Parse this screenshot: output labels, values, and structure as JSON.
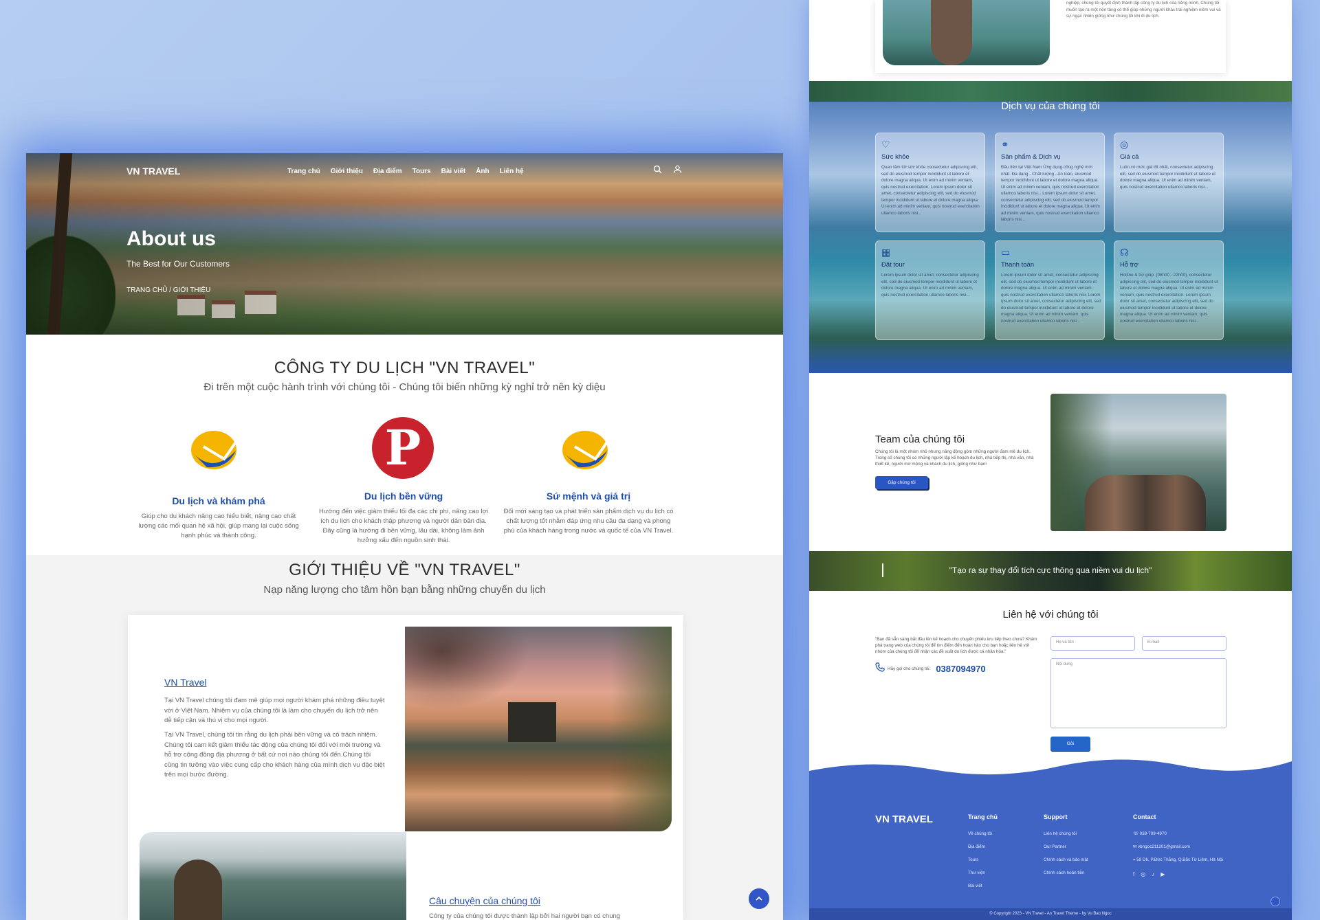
{
  "brand": "VN TRAVEL",
  "nav": [
    "Trang chủ",
    "Giới thiệu",
    "Địa điểm",
    "Tours",
    "Bài viết",
    "Ảnh",
    "Liên hệ"
  ],
  "hero": {
    "title": "About us",
    "subtitle": "The Best for Our Customers",
    "breadcrumb": "TRANG CHỦ / GIỚI THIỆU"
  },
  "company": {
    "title": "CÔNG TY DU LỊCH \"VN TRAVEL\"",
    "subtitle": "Đi trên một cuộc hành trình với chúng tôi - Chúng tôi biến những kỳ nghỉ trở nên kỳ diệu"
  },
  "features": [
    {
      "title": "Du lịch và khám phá",
      "text": "Giúp cho du khách nâng cao hiểu biết, nâng cao chất lượng các mối quan hệ xã hội, giúp mang lại cuộc sống hạnh phúc và thành công."
    },
    {
      "title": "Du lịch bền vững",
      "text": "Hướng đến việc giảm thiểu tối đa các chi phí, nâng cao lợi ích du lịch cho khách thập phương và người dân bản địa. Đây cũng là hướng đi bền vững, lâu dài, không làm ảnh hưởng xấu đến nguồn sinh thái."
    },
    {
      "title": "Sứ mệnh và giá trị",
      "text": "Đổi mới sáng tạo và phát triển sản phẩm dịch vụ du lịch có chất lượng tốt nhằm đáp ứng nhu cầu đa dạng và phong phú của khách hàng trong nước và quốc tế của VN Travel."
    }
  ],
  "about": {
    "title": "GIỚI THIỆU VỀ \"VN TRAVEL\"",
    "subtitle": "Nạp năng lượng cho tâm hồn bạn bằng những chuyến du lịch",
    "link1": "VN Travel",
    "p1": "Tại VN Travel chúng tôi đam mê giúp mọi người khám phá những điều tuyệt vời ở Việt Nam. Nhiệm vụ của chúng tôi là làm cho chuyến du lịch trở nên dễ tiếp cận và thú vị cho mọi người.",
    "p2": "Tại VN Travel, chúng tôi tin rằng du lịch phải bền vững và có trách nhiệm. Chúng tôi cam kết giảm thiểu tác động của chúng tôi đối với môi trường và hỗ trợ cộng đồng địa phương ở bất cứ nơi nào chúng tôi đến.Chúng tôi cũng tin tưởng vào việc cung cấp cho khách hàng của mình dịch vụ đặc biệt trên mọi bước đường.",
    "link2": "Câu chuyện của chúng tôi",
    "p3": "Công ty của chúng tôi được thành lập bởi hai người bạn có chung"
  },
  "story_snippet": "nghiệp, chúng tôi quyết định thành lập công ty du lịch của riêng mình. Chúng tôi muốn tạo ra một nền tảng có thể giúp những người khác trải nghiệm niềm vui và sự ngạc nhiên giống như chúng tôi khi đi du lịch.",
  "services": {
    "title": "Dịch vụ của chúng tôi",
    "items": [
      {
        "icon": "hand-heart-icon",
        "title": "Sức khỏe",
        "text": "Quan tâm tới sức khỏe consectetur adipiscing elit, sed do eiusmod tempor incididunt ut labore et dolore magna aliqua. Ut enim ad minim veniam, quis nostrud exercitation. Lorem ipsum dolor sit amet, consectetur adipiscing elit, sed do eiusmod tempor incididunt ut labore et dolore magna aliqua. Ut enim ad minim veniam, quis nostrud exercitation ullamco laboris nisi..."
      },
      {
        "icon": "handshake-icon",
        "title": "Sản phẩm & Dịch vụ",
        "text": "Đầu tiên tại Việt Nam Ứng dụng công nghệ mới nhất. Đa dạng - Chất lượng - An toàn, eiusmod tempor incididunt ut labore et dolore magna aliqua. Ut enim ad minim veniam, quis nostrud exercitation ullamco laboris nisi... Lorem ipsum dolor sit amet, consectetur adipiscing elit, sed do eiusmod tempor incididunt ut labore et dolore magna aliqua. Ut enim ad minim veniam, quis nostrud exercitation ullamco laboris nisi..."
      },
      {
        "icon": "hand-coin-icon",
        "title": "Giá cả",
        "text": "Luôn có mức giá tốt nhất, consectetur adipiscing elit, sed do eiusmod tempor incididunt ut labore et dolore magna aliqua. Ut enim ad minim veniam, quis nostrud exercitation ullamco laboris nisi..."
      },
      {
        "icon": "building-icon",
        "title": "Đặt tour",
        "text": "Lorem ipsum dolor sit amet, consectetur adipiscing elit, sed do eiusmod tempor incididunt ut labore et dolore magna aliqua. Ut enim ad minim veniam, quis nostrud exercitation ullamco laboris nisi..."
      },
      {
        "icon": "card-icon",
        "title": "Thanh toán",
        "text": "Lorem ipsum dolor sit amet, consectetur adipiscing elit, sed do eiusmod tempor incididunt ut labore et dolore magna aliqua. Ut enim ad minim veniam, quis nostrud exercitation ullamco laboris nisi. Lorem ipsum dolor sit amet, consectetur adipiscing elit, sed do eiusmod tempor incididunt ut labore et dolore magna aliqua. Ut enim ad minim veniam, quis nostrud exercitation ullamco laboris nisi..."
      },
      {
        "icon": "headset-icon",
        "title": "Hỗ trợ",
        "text": "Hotline & trợ giúp: (08h00 - 22h00), consectetur adipiscing elit, sed do eiusmod tempor incididunt ut labore et dolore magna aliqua. Ut enim ad minim veniam, quis nostrud exercitation. Lorem ipsum dolor sit amet, consectetur adipiscing elit, sed do eiusmod tempor incididunt ut labore et dolore magna aliqua. Ut enim ad minim veniam, quis nostrud exercitation ullamco laboris nisi..."
      }
    ]
  },
  "team": {
    "title": "Team của chúng tôi",
    "text": "Chúng tôi là một nhóm nhỏ nhưng năng động gồm những người đam mê du lịch. Trong số chúng tôi có những người lập kế hoạch du lịch, nhà tiếp thị, nhà văn, nhà thiết kế, người mơ mộng và khách du lịch, giống như bạn!",
    "button": "Gặp chúng tôi"
  },
  "quote": "\"Tạo ra sự thay đổi tích cực thông qua niềm vui du lịch\"",
  "contact": {
    "title": "Liên hệ với chúng tôi",
    "text": "\"Bạn đã sẵn sàng bắt đầu lên kế hoạch cho chuyến phiêu lưu tiếp theo chưa? Khám phá trang web của chúng tôi để tìm điểm đến hoàn hảo cho bạn hoặc liên hệ với nhóm của chúng tôi để nhận các đề xuất du lịch được cá nhân hóa.\"",
    "call_label": "Hãy gọi cho chúng tôi:",
    "phone": "0387094970",
    "name_ph": "Họ và tên",
    "email_ph": "E-mail",
    "msg_ph": "Nội dung",
    "send": "Gửi"
  },
  "footer": {
    "brand": "VN TRAVEL",
    "col1": {
      "title": "Trang chủ",
      "items": [
        "Về chúng tôi",
        "Địa điểm",
        "Tours",
        "Thư viện",
        "Bài viết"
      ]
    },
    "col2": {
      "title": "Support",
      "items": [
        "Liên hệ chúng tôi",
        "Our Partner",
        "Chính sách và bảo mật",
        "Chính sách hoàn tiền"
      ]
    },
    "col3": {
      "title": "Contact",
      "phone": "038-709-4970",
      "email": "vbngoc211201@gmail.com",
      "address": "59 Dh, P.Đức Thắng, Q.Bắc Từ Liêm, Hà Nội"
    },
    "copyright": "© Copyright 2023 - VN Travel - An Travel Theme - by Vu Bao Ngoc"
  },
  "colors": {
    "accent": "#1f4ea8",
    "footer": "#3f64c4",
    "bg": "#a6c2ef"
  }
}
